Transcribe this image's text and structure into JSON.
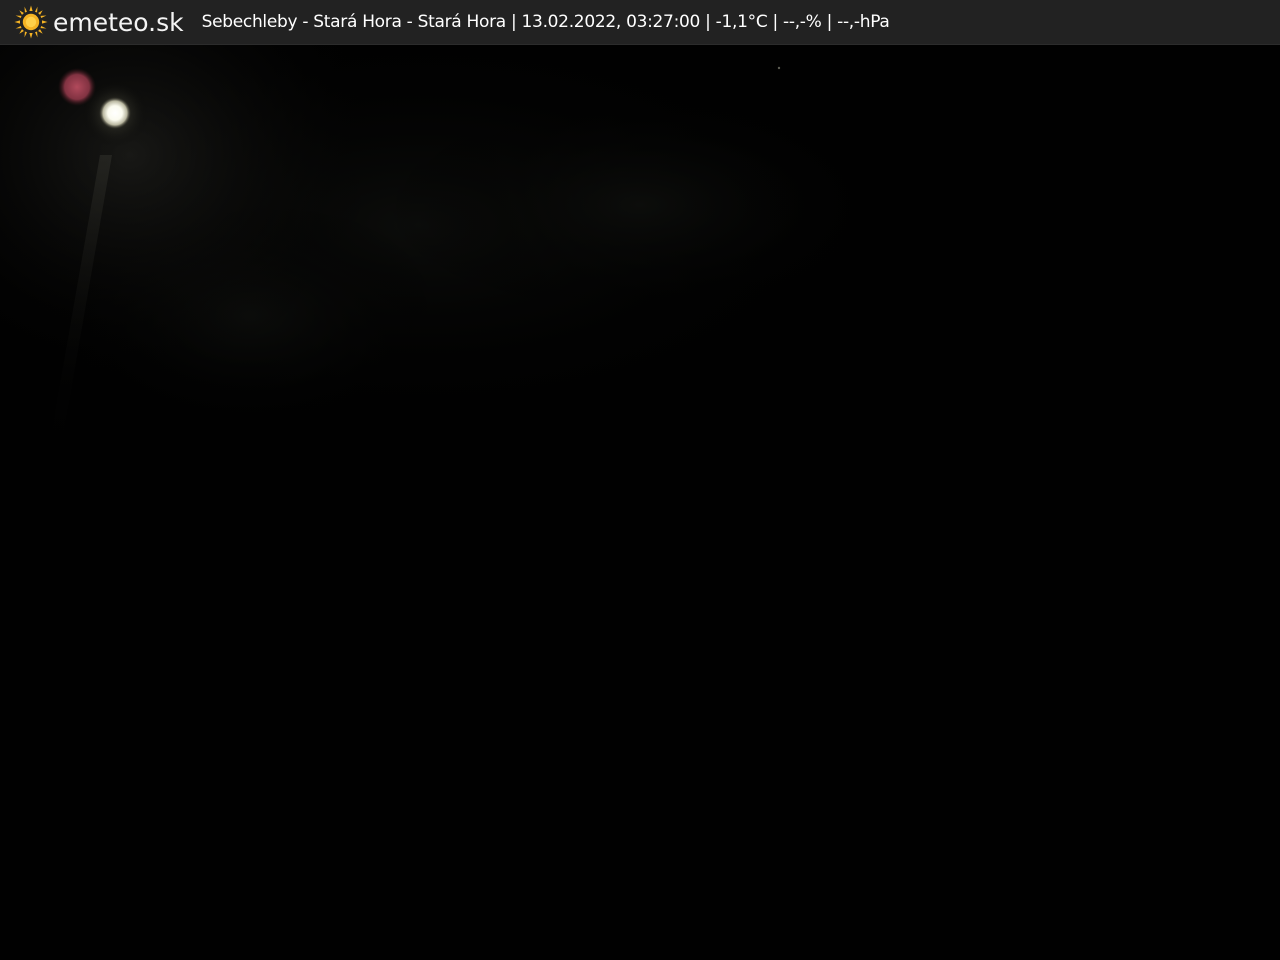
{
  "brand": {
    "name": "emeteo.sk",
    "icon": "sun-icon",
    "icon_color": "#f5b324"
  },
  "caption": {
    "location": "Sebechleby - Stará Hora - Stará Hora",
    "datetime": "13.02.2022, 03:27:00",
    "temperature": "-1,1°C",
    "humidity": "--,-%",
    "pressure": "--,-hPa",
    "full_text": "Sebechleby - Stará Hora - Stará Hora | 13.02.2022, 03:27:00 | -1,1°C | --,-% | --,-hPa"
  },
  "colors": {
    "bar_background": "#222222",
    "scene_background": "#010101"
  }
}
